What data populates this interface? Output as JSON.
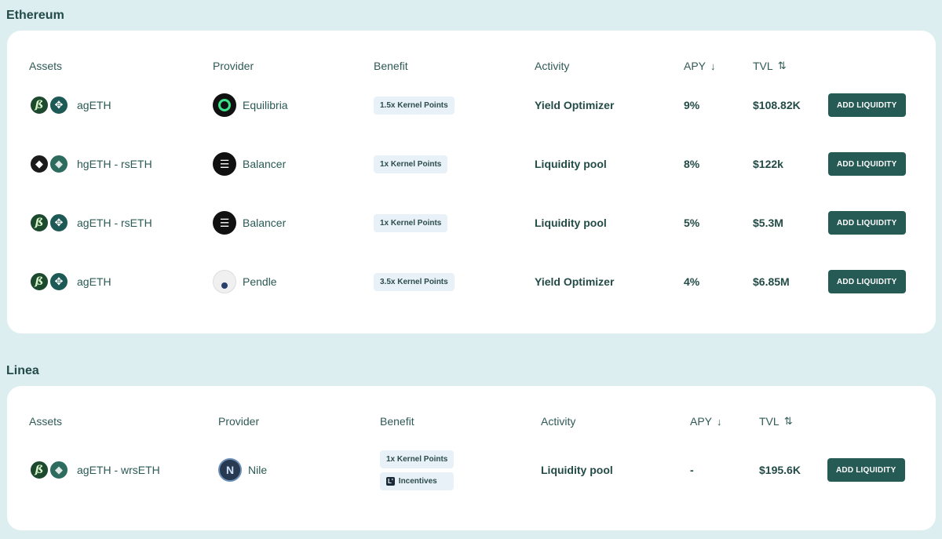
{
  "sections": [
    {
      "title": "Ethereum",
      "headers": {
        "assets": "Assets",
        "provider": "Provider",
        "benefit": "Benefit",
        "activity": "Activity",
        "apy": "APY",
        "tvl": "TVL"
      },
      "rows": [
        {
          "asset": "agETH",
          "icons": [
            "ageth-icon",
            "kernel-icon"
          ],
          "provider": "Equilibria",
          "provider_icon": "equilibria-icon",
          "benefits": [
            "1.5x Kernel Points"
          ],
          "activity": "Yield Optimizer",
          "apy": "9%",
          "tvl": "$108.82K",
          "action": "ADD LIQUIDITY"
        },
        {
          "asset": "hgETH - rsETH",
          "icons": [
            "hgeth-icon",
            "rseth-icon"
          ],
          "provider": "Balancer",
          "provider_icon": "balancer-icon",
          "benefits": [
            "1x Kernel Points"
          ],
          "activity": "Liquidity pool",
          "apy": "8%",
          "tvl": "$122k",
          "action": "ADD LIQUIDITY"
        },
        {
          "asset": "agETH - rsETH",
          "icons": [
            "ageth-icon",
            "kernel-icon"
          ],
          "provider": "Balancer",
          "provider_icon": "balancer-icon",
          "benefits": [
            "1x Kernel Points"
          ],
          "activity": "Liquidity pool",
          "apy": "5%",
          "tvl": "$5.3M",
          "action": "ADD LIQUIDITY"
        },
        {
          "asset": "agETH",
          "icons": [
            "ageth-icon",
            "kernel-icon"
          ],
          "provider": "Pendle",
          "provider_icon": "pendle-icon",
          "benefits": [
            "3.5x Kernel Points"
          ],
          "activity": "Yield Optimizer",
          "apy": "4%",
          "tvl": "$6.85M",
          "action": "ADD LIQUIDITY"
        }
      ]
    },
    {
      "title": "Linea",
      "headers": {
        "assets": "Assets",
        "provider": "Provider",
        "benefit": "Benefit",
        "activity": "Activity",
        "apy": "APY",
        "tvl": "TVL"
      },
      "rows": [
        {
          "asset": "agETH - wrsETH",
          "icons": [
            "ageth-icon",
            "rseth-icon"
          ],
          "provider": "Nile",
          "provider_icon": "nile-icon",
          "benefits": [
            "1x Kernel Points",
            "Incentives"
          ],
          "activity": "Liquidity pool",
          "apy": "-",
          "tvl": "$195.6K",
          "action": "ADD LIQUIDITY"
        }
      ]
    }
  ],
  "colors": {
    "background": "#dceef0",
    "card": "#ffffff",
    "button": "#265a55",
    "badge": "#e8f1f7",
    "text": "#234b47"
  }
}
